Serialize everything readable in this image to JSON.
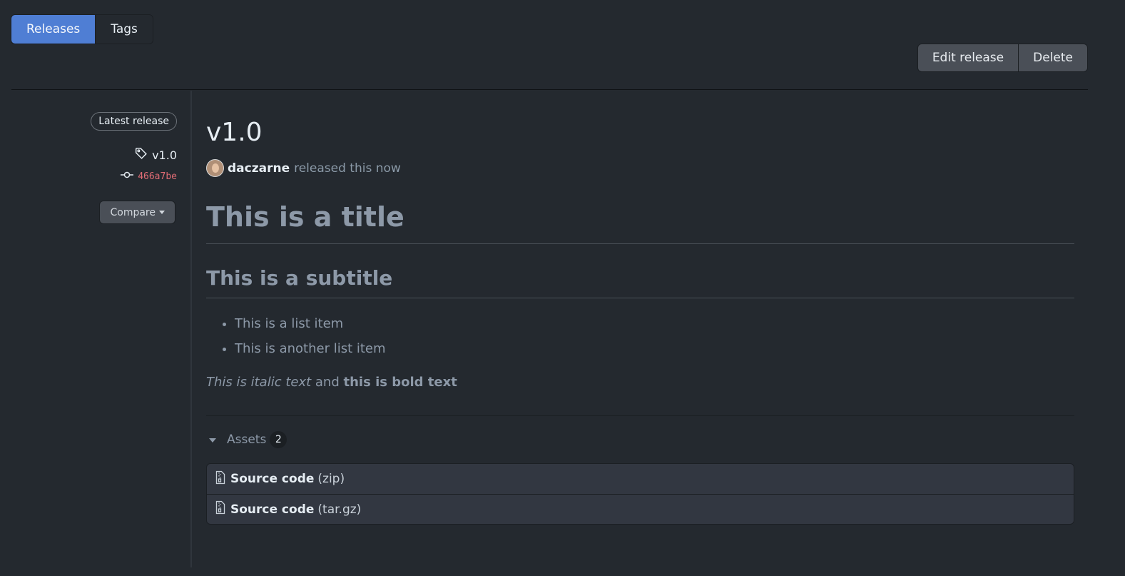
{
  "tabs": [
    {
      "label": "Releases",
      "active": true
    },
    {
      "label": "Tags",
      "active": false
    }
  ],
  "actions": {
    "edit_label": "Edit release",
    "delete_label": "Delete"
  },
  "sidebar": {
    "badge": "Latest release",
    "tag": "v1.0",
    "tag_icon": "tag-icon",
    "commit": "466a7be",
    "commit_icon": "git-commit-icon",
    "compare_label": "Compare"
  },
  "release": {
    "version": "v1.0",
    "author": "daczarne",
    "released_text": "released this now"
  },
  "body": {
    "title": "This is a title",
    "subtitle": "This is a subtitle",
    "list": [
      "This is a list item",
      "This is another list item"
    ],
    "italic": "This is italic text",
    "and": "and",
    "bold": "this is bold text"
  },
  "assets": {
    "label": "Assets",
    "count": "2",
    "items": [
      {
        "name": "Source code",
        "ext": "(zip)",
        "icon": "file-zip-icon"
      },
      {
        "name": "Source code",
        "ext": "(tar.gz)",
        "icon": "file-zip-icon"
      }
    ]
  },
  "colors": {
    "background": "#24292f",
    "accent": "#4f7ed4",
    "commit": "#e06c75"
  }
}
